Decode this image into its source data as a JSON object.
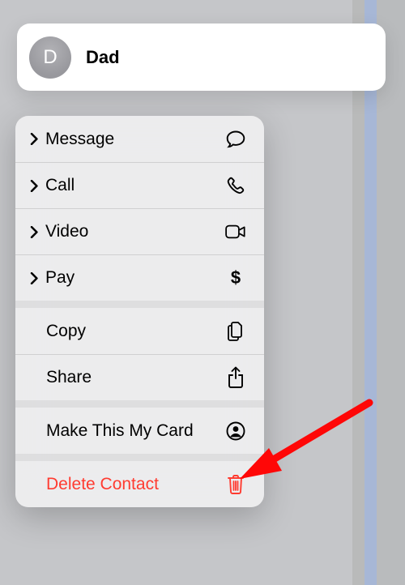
{
  "contact": {
    "initial": "D",
    "name": "Dad"
  },
  "menu": {
    "message": "Message",
    "call": "Call",
    "video": "Video",
    "pay": "Pay",
    "dollar": "$",
    "copy": "Copy",
    "share": "Share",
    "make_my_card": "Make This My Card",
    "delete": "Delete Contact"
  },
  "colors": {
    "danger": "#ff3b30",
    "arrow": "#ff0707"
  }
}
